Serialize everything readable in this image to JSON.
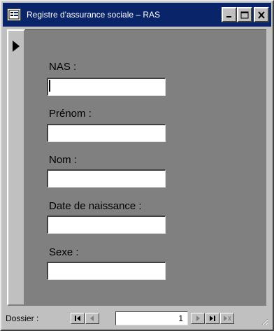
{
  "window": {
    "title": "Registre d'assurance sociale – RAS"
  },
  "form": {
    "fields": [
      {
        "label": "NAS :",
        "value": ""
      },
      {
        "label": "Prénom :",
        "value": ""
      },
      {
        "label": "Nom :",
        "value": ""
      },
      {
        "label": "Date de naissance :",
        "value": ""
      },
      {
        "label": "Sexe :",
        "value": ""
      }
    ]
  },
  "navigation": {
    "label": "Dossier :",
    "current_record": "1"
  },
  "icons": {
    "form": "form-view-icon",
    "minimize": "minimize-icon",
    "maximize": "maximize-icon",
    "close": "close-icon",
    "first": "first-record-icon",
    "prev": "previous-record-icon",
    "next": "next-record-icon",
    "last": "last-record-icon",
    "new": "new-record-icon"
  },
  "colors": {
    "titlebar": "#0a246a",
    "form_background": "#808080",
    "chrome": "#c0c0c0"
  }
}
